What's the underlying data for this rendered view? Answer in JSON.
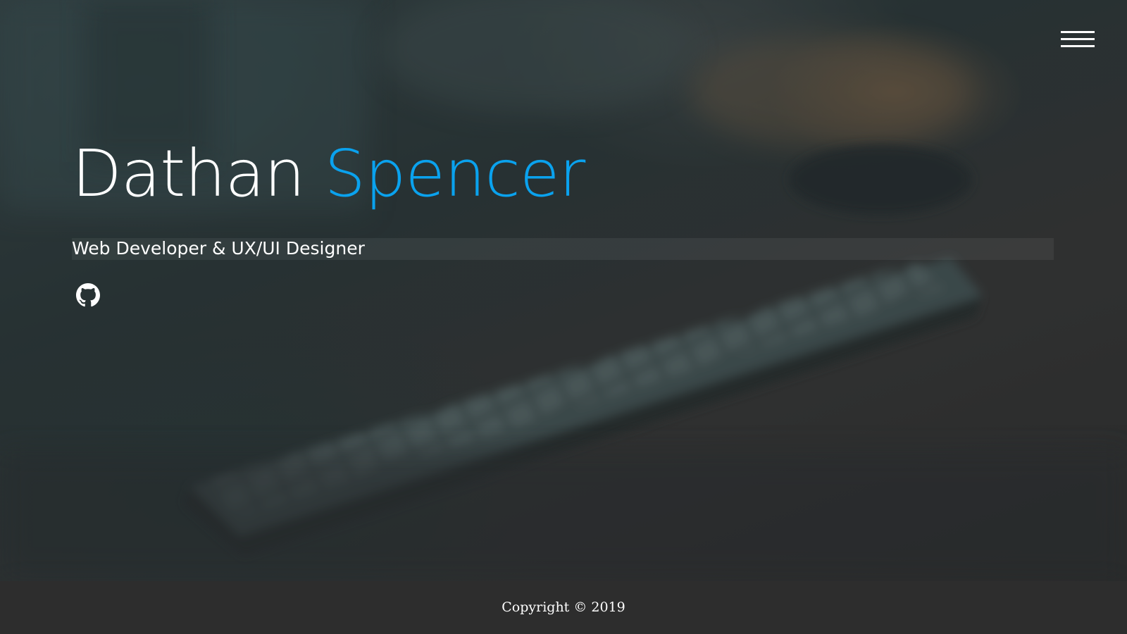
{
  "header": {
    "menu_icon": "hamburger-menu-icon"
  },
  "hero": {
    "name_first": "Dathan",
    "name_last": "Spencer",
    "subtitle": "Web Developer & UX/UI Designer",
    "social_icon": "github-icon",
    "accent_color": "#0aa2ee"
  },
  "footer": {
    "copyright": "Copyright © 2019"
  }
}
